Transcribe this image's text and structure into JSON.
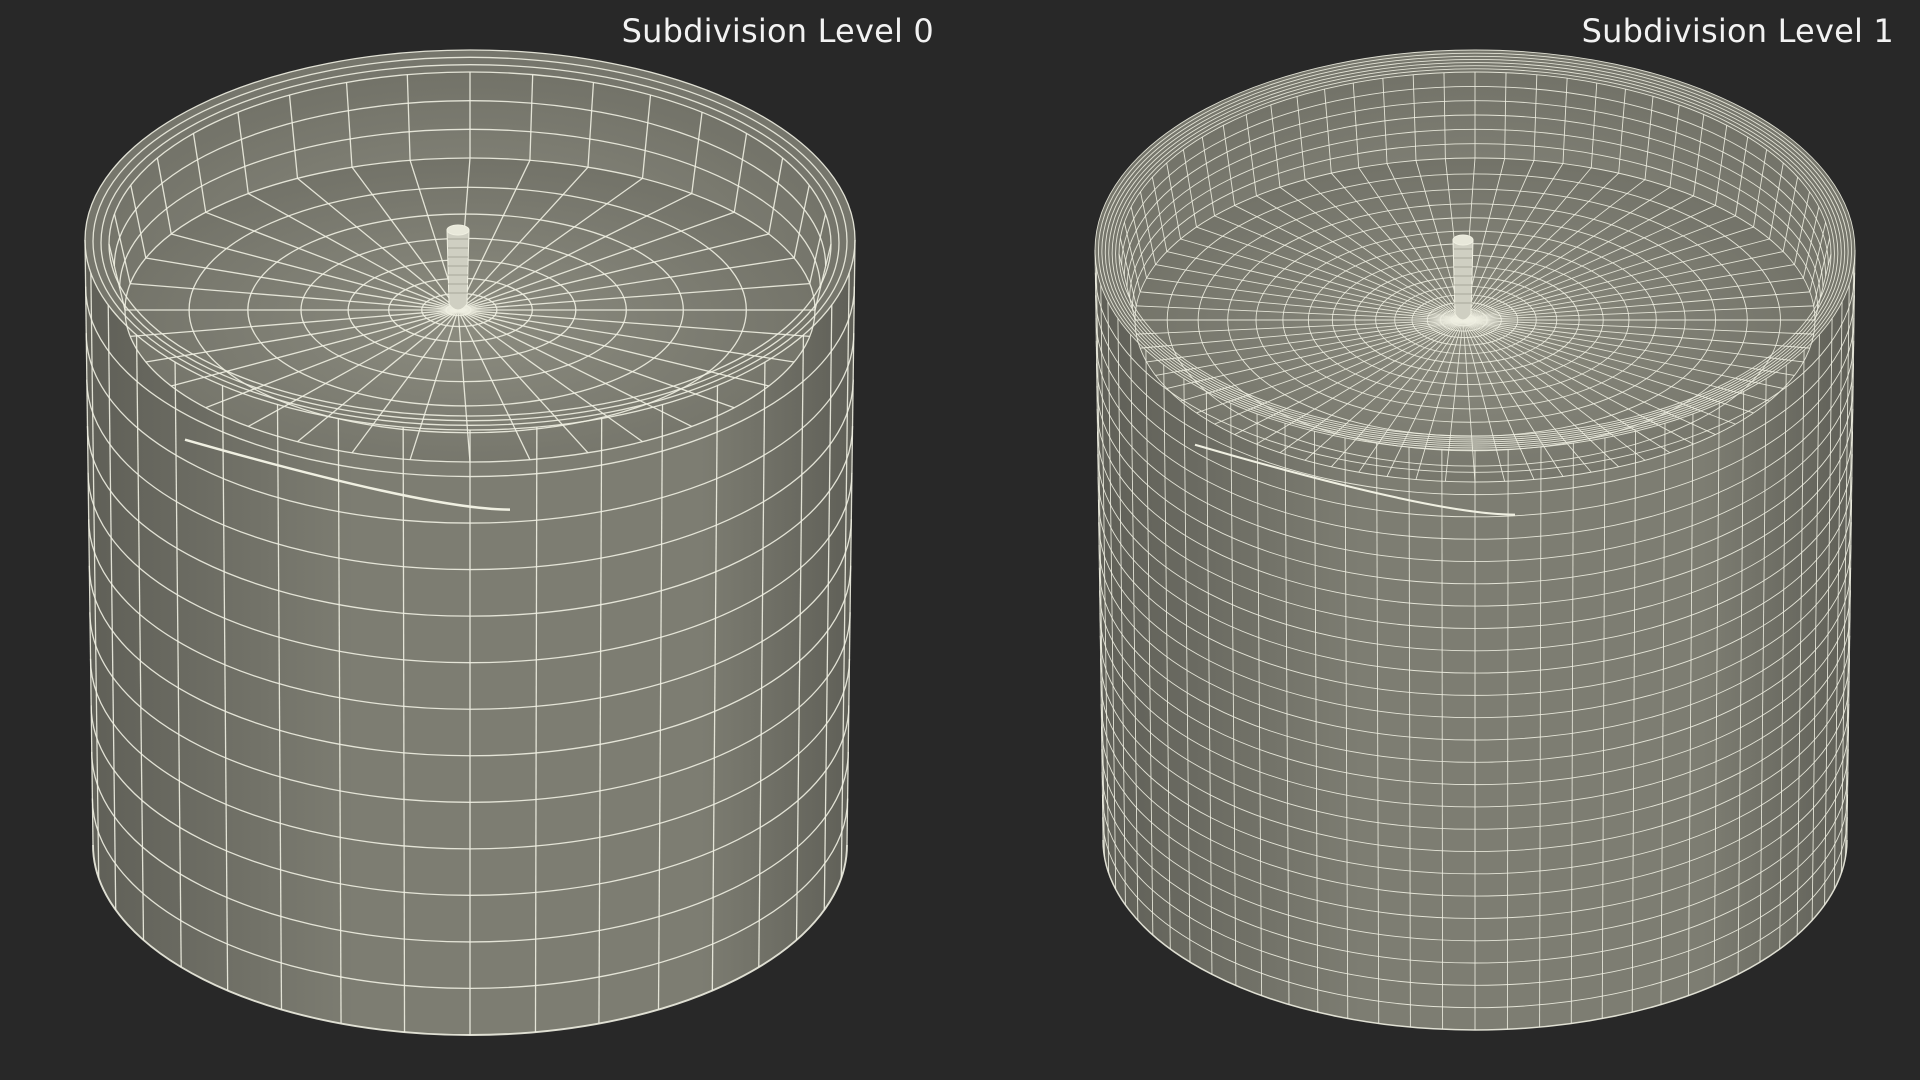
{
  "labels": {
    "left": "Subdivision Level 0",
    "right": "Subdivision Level 1"
  },
  "models": [
    {
      "subdivision_level": 0
    },
    {
      "subdivision_level": 1
    }
  ],
  "colors": {
    "background": "#282828",
    "surface": "#7d7d72",
    "surface_dark": "#5f5f57",
    "inner_surface": "#86867b",
    "wire": "#f0f0e2",
    "text": "#f2f2f2"
  }
}
